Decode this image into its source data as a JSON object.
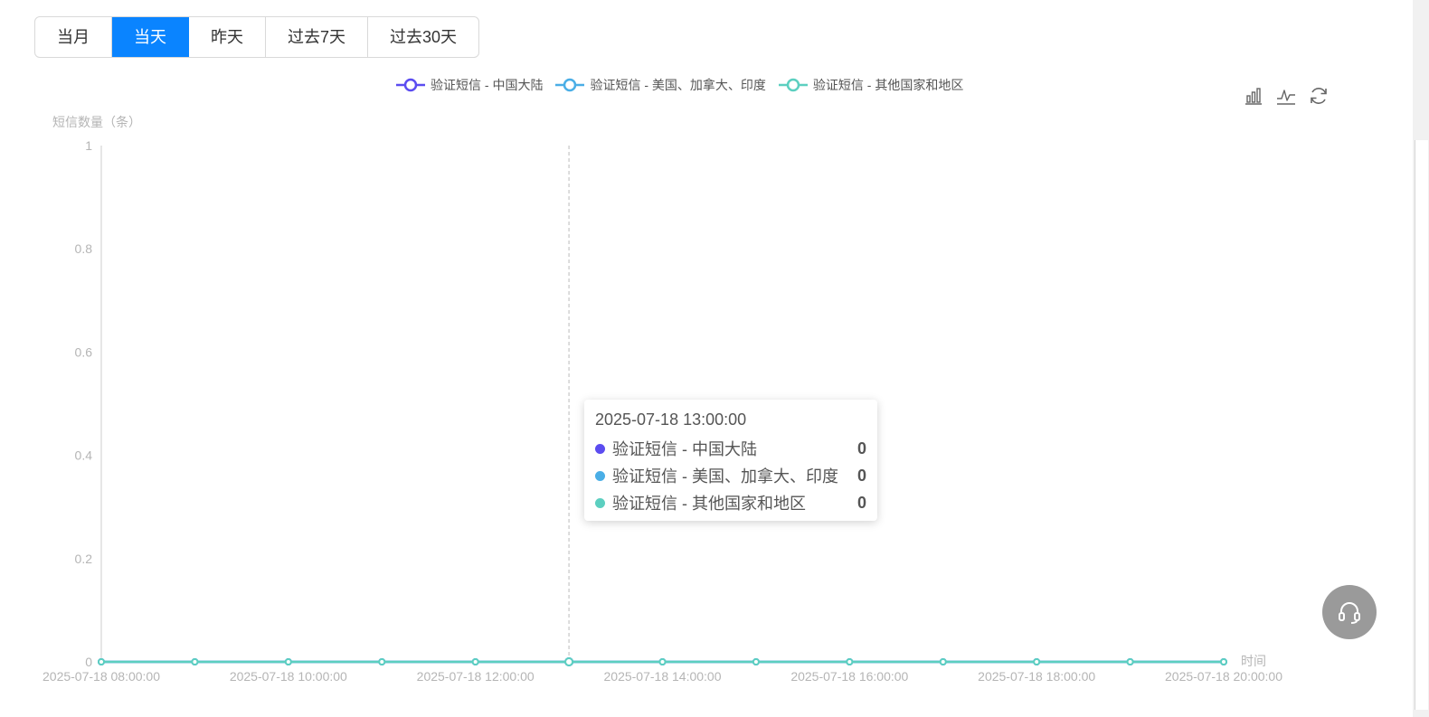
{
  "tabs": [
    {
      "label": "当月",
      "active": false
    },
    {
      "label": "当天",
      "active": true
    },
    {
      "label": "昨天",
      "active": false
    },
    {
      "label": "过去7天",
      "active": false
    },
    {
      "label": "过去30天",
      "active": false
    }
  ],
  "toolbox": {
    "bar_icon": "bar-chart-icon",
    "line_icon": "line-chart-icon",
    "refresh_icon": "refresh-icon"
  },
  "tooltip": {
    "title": "2025-07-18 13:00:00",
    "rows": [
      {
        "name": "验证短信 - 中国大陆",
        "value": "0",
        "color": "#5b4cf0"
      },
      {
        "name": "验证短信 - 美国、加拿大、印度",
        "value": "0",
        "color": "#4aaee6"
      },
      {
        "name": "验证短信 - 其他国家和地区",
        "value": "0",
        "color": "#5ccfc0"
      }
    ]
  },
  "support_icon": "headset-icon",
  "chart_data": {
    "type": "line",
    "ylabel": "短信数量（条）",
    "xlabel": "时间",
    "ylim": [
      0,
      1
    ],
    "y_ticks": [
      "0",
      "0.2",
      "0.4",
      "0.6",
      "0.8",
      "1"
    ],
    "x": [
      "2025-07-18 08:00:00",
      "2025-07-18 09:00:00",
      "2025-07-18 10:00:00",
      "2025-07-18 11:00:00",
      "2025-07-18 12:00:00",
      "2025-07-18 13:00:00",
      "2025-07-18 14:00:00",
      "2025-07-18 15:00:00",
      "2025-07-18 16:00:00",
      "2025-07-18 17:00:00",
      "2025-07-18 18:00:00",
      "2025-07-18 19:00:00",
      "2025-07-18 20:00:00"
    ],
    "x_tick_labels": [
      "2025-07-18 08:00:00",
      "2025-07-18 10:00:00",
      "2025-07-18 12:00:00",
      "2025-07-18 14:00:00",
      "2025-07-18 16:00:00",
      "2025-07-18 18:00:00",
      "2025-07-18 20:00:00"
    ],
    "highlight_x": "2025-07-18 13:00:00",
    "legend_position": "top-center",
    "grid": false,
    "series": [
      {
        "name": "验证短信 - 中国大陆",
        "color": "#5b4cf0",
        "values": [
          0,
          0,
          0,
          0,
          0,
          0,
          0,
          0,
          0,
          0,
          0,
          0,
          0
        ]
      },
      {
        "name": "验证短信 - 美国、加拿大、印度",
        "color": "#4aaee6",
        "values": [
          0,
          0,
          0,
          0,
          0,
          0,
          0,
          0,
          0,
          0,
          0,
          0,
          0
        ]
      },
      {
        "name": "验证短信 - 其他国家和地区",
        "color": "#5ccfc0",
        "values": [
          0,
          0,
          0,
          0,
          0,
          0,
          0,
          0,
          0,
          0,
          0,
          0,
          0
        ]
      }
    ]
  }
}
